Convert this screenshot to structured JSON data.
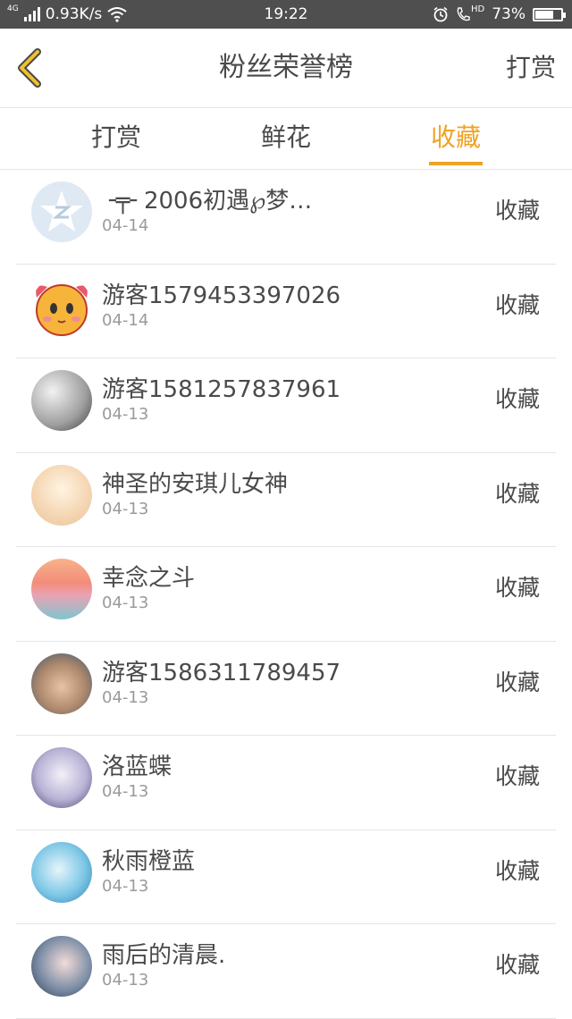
{
  "status_bar": {
    "net_type": "4G",
    "speed": "0.93K/s",
    "time": "19:22",
    "hd": "HD",
    "battery": "73%",
    "battery_level": 0.73
  },
  "header": {
    "title": "粉丝荣誉榜",
    "action": "打赏"
  },
  "tabs": [
    {
      "label": "打赏",
      "active": false
    },
    {
      "label": "鲜花",
      "active": false
    },
    {
      "label": "收藏",
      "active": true
    }
  ],
  "fans": [
    {
      "name": "╶╤╴2006初遇℘梦…",
      "date": "04-14",
      "badge": "收藏"
    },
    {
      "name": "游客1579453397026",
      "date": "04-14",
      "badge": "收藏"
    },
    {
      "name": "游客1581257837961",
      "date": "04-13",
      "badge": "收藏"
    },
    {
      "name": "神圣的安琪儿女神",
      "date": "04-13",
      "badge": "收藏"
    },
    {
      "name": "幸念之斗",
      "date": "04-13",
      "badge": "收藏"
    },
    {
      "name": "游客1586311789457",
      "date": "04-13",
      "badge": "收藏"
    },
    {
      "name": "洛蓝蝶",
      "date": "04-13",
      "badge": "收藏"
    },
    {
      "name": "秋雨橙蓝",
      "date": "04-13",
      "badge": "收藏"
    },
    {
      "name": "雨后的清晨.",
      "date": "04-13",
      "badge": "收藏"
    }
  ],
  "colors": {
    "accent": "#f0a224",
    "status_bar": "#4f4f4f",
    "back_icon": "#f0c030"
  },
  "icons": [
    "signal-icon",
    "wifi-icon",
    "alarm-icon",
    "call-icon",
    "battery-icon",
    "back-chevron-icon"
  ]
}
